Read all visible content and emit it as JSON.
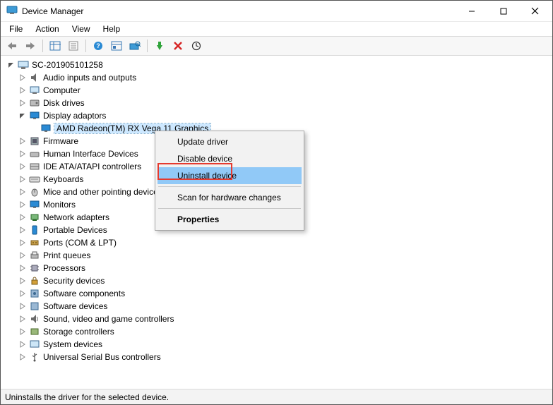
{
  "window": {
    "title": "Device Manager"
  },
  "menubar": {
    "file": "File",
    "action": "Action",
    "view": "View",
    "help": "Help"
  },
  "root": {
    "label": "SC-201905101258"
  },
  "display": {
    "label": "Display adaptors",
    "child": "AMD Radeon(TM) RX Vega 11 Graphics"
  },
  "nodes": {
    "audio": "Audio inputs and outputs",
    "computer": "Computer",
    "disk": "Disk drives",
    "firmware": "Firmware",
    "hid": "Human Interface Devices",
    "ide": "IDE ATA/ATAPI controllers",
    "keyboards": "Keyboards",
    "mice": "Mice and other pointing devices",
    "monitors": "Monitors",
    "network": "Network adapters",
    "portable": "Portable Devices",
    "ports": "Ports (COM & LPT)",
    "printq": "Print queues",
    "processors": "Processors",
    "security": "Security devices",
    "swcomp": "Software components",
    "swdev": "Software devices",
    "sound": "Sound, video and game controllers",
    "storage": "Storage controllers",
    "system": "System devices",
    "usb": "Universal Serial Bus controllers"
  },
  "context_menu": {
    "update": "Update driver",
    "disable": "Disable device",
    "uninstall": "Uninstall device",
    "scan": "Scan for hardware changes",
    "properties": "Properties"
  },
  "statusbar": "Uninstalls the driver for the selected device."
}
